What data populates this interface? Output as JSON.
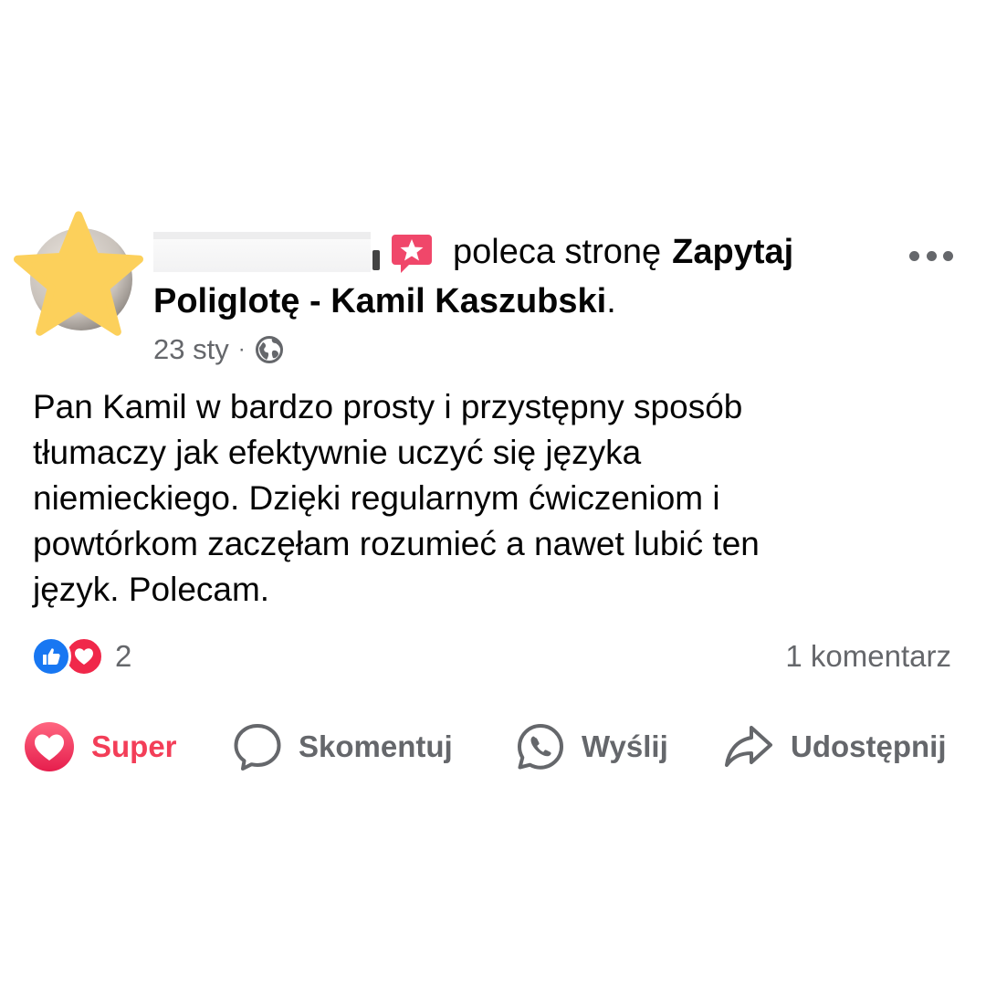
{
  "post": {
    "recommend_text": "poleca stronę",
    "page_name_line1": "Zapytaj",
    "page_name_line2": "Poliglotę - Kamil Kaszubski",
    "page_name_period": ".",
    "date": "23 sty",
    "separator": "·",
    "audience_icon": "globe-icon",
    "more_icon": "more-options-icon",
    "body_lines": [
      "Pan Kamil w bardzo prosty i przystępny sposób",
      "tłumaczy jak efektywnie uczyć się języka",
      "niemieckiego. Dzięki regularnym ćwiczeniom i",
      "powtórkom zaczęłam rozumieć a nawet lubić ten",
      "język. Polecam."
    ]
  },
  "reactions": {
    "icons": [
      "like-icon",
      "love-icon"
    ],
    "count": "2",
    "comments_label": "1 komentarz"
  },
  "actions": {
    "super_label": "Super",
    "comment_label": "Skomentuj",
    "send_label": "Wyślij",
    "share_label": "Udostępnij"
  },
  "colors": {
    "super_red": "#f33e58",
    "like_blue": "#1877f2",
    "love_red": "#f0284a",
    "secondary_text": "#65676b",
    "avatar_star": "#fcd05b",
    "recommend_badge": "#f0476a"
  }
}
